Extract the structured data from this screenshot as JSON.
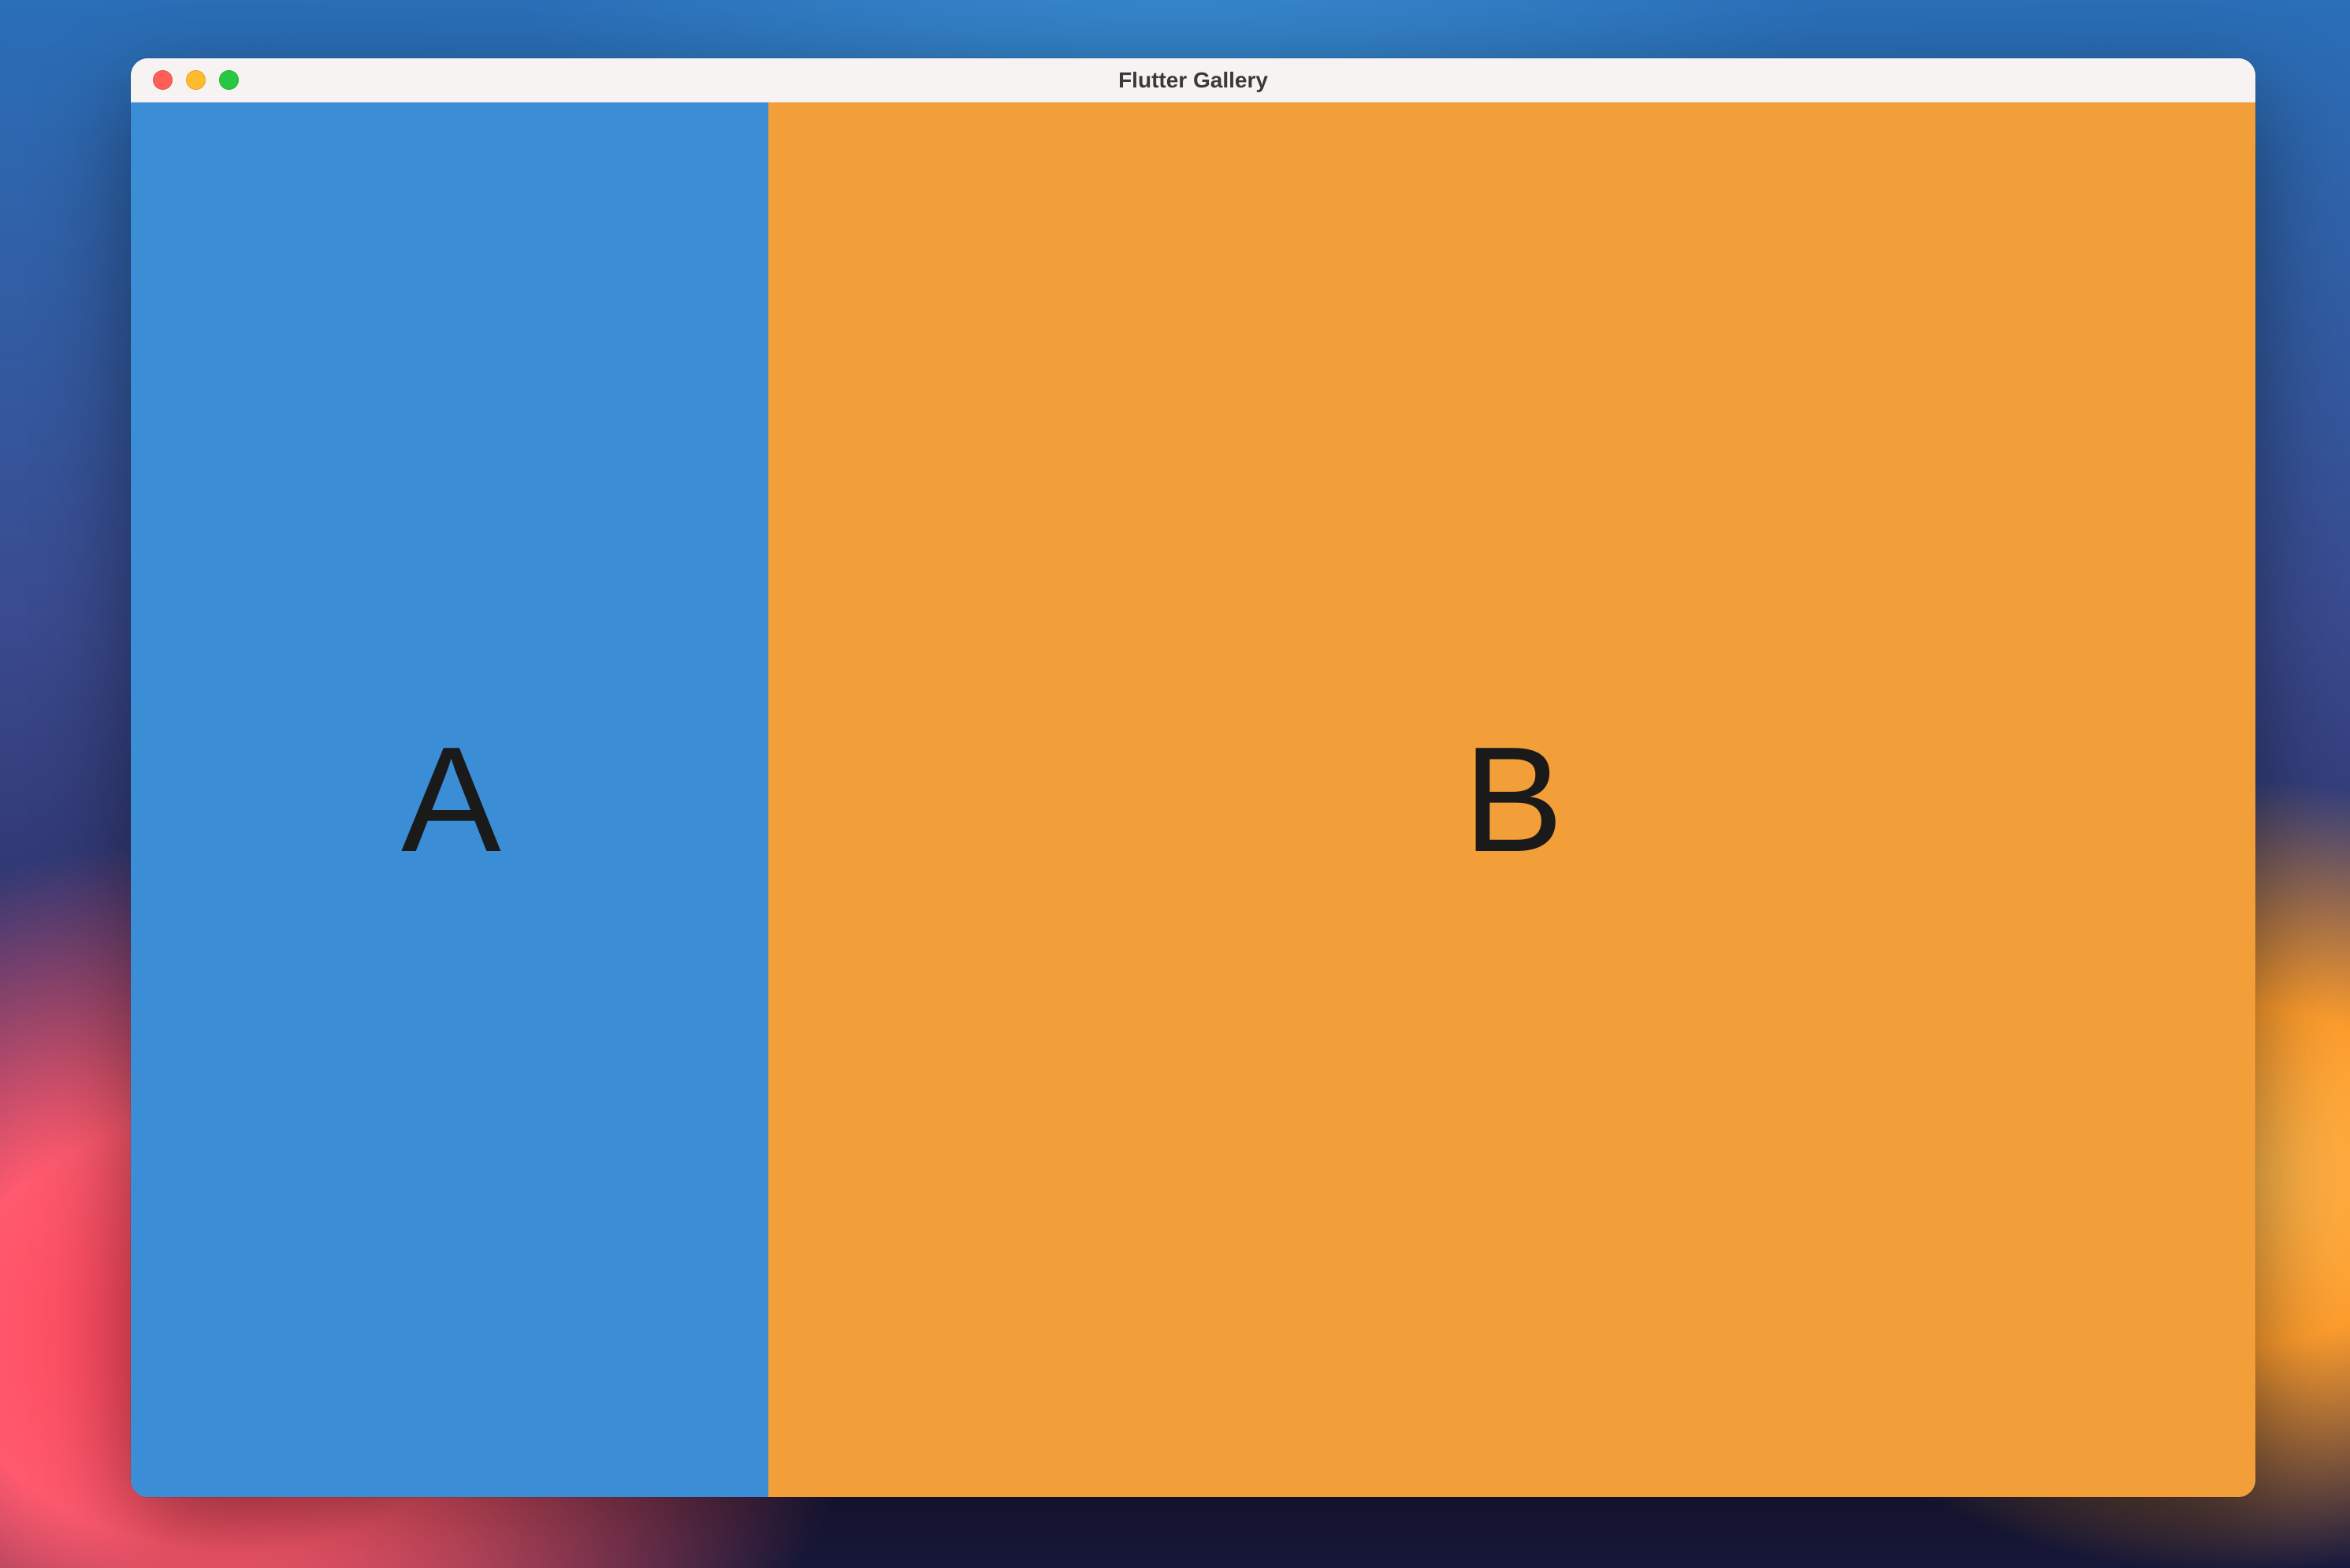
{
  "window": {
    "title": "Flutter Gallery"
  },
  "panes": {
    "a": {
      "label": "A",
      "color": "#3b8ed6"
    },
    "b": {
      "label": "B",
      "color": "#f29f3a"
    }
  }
}
